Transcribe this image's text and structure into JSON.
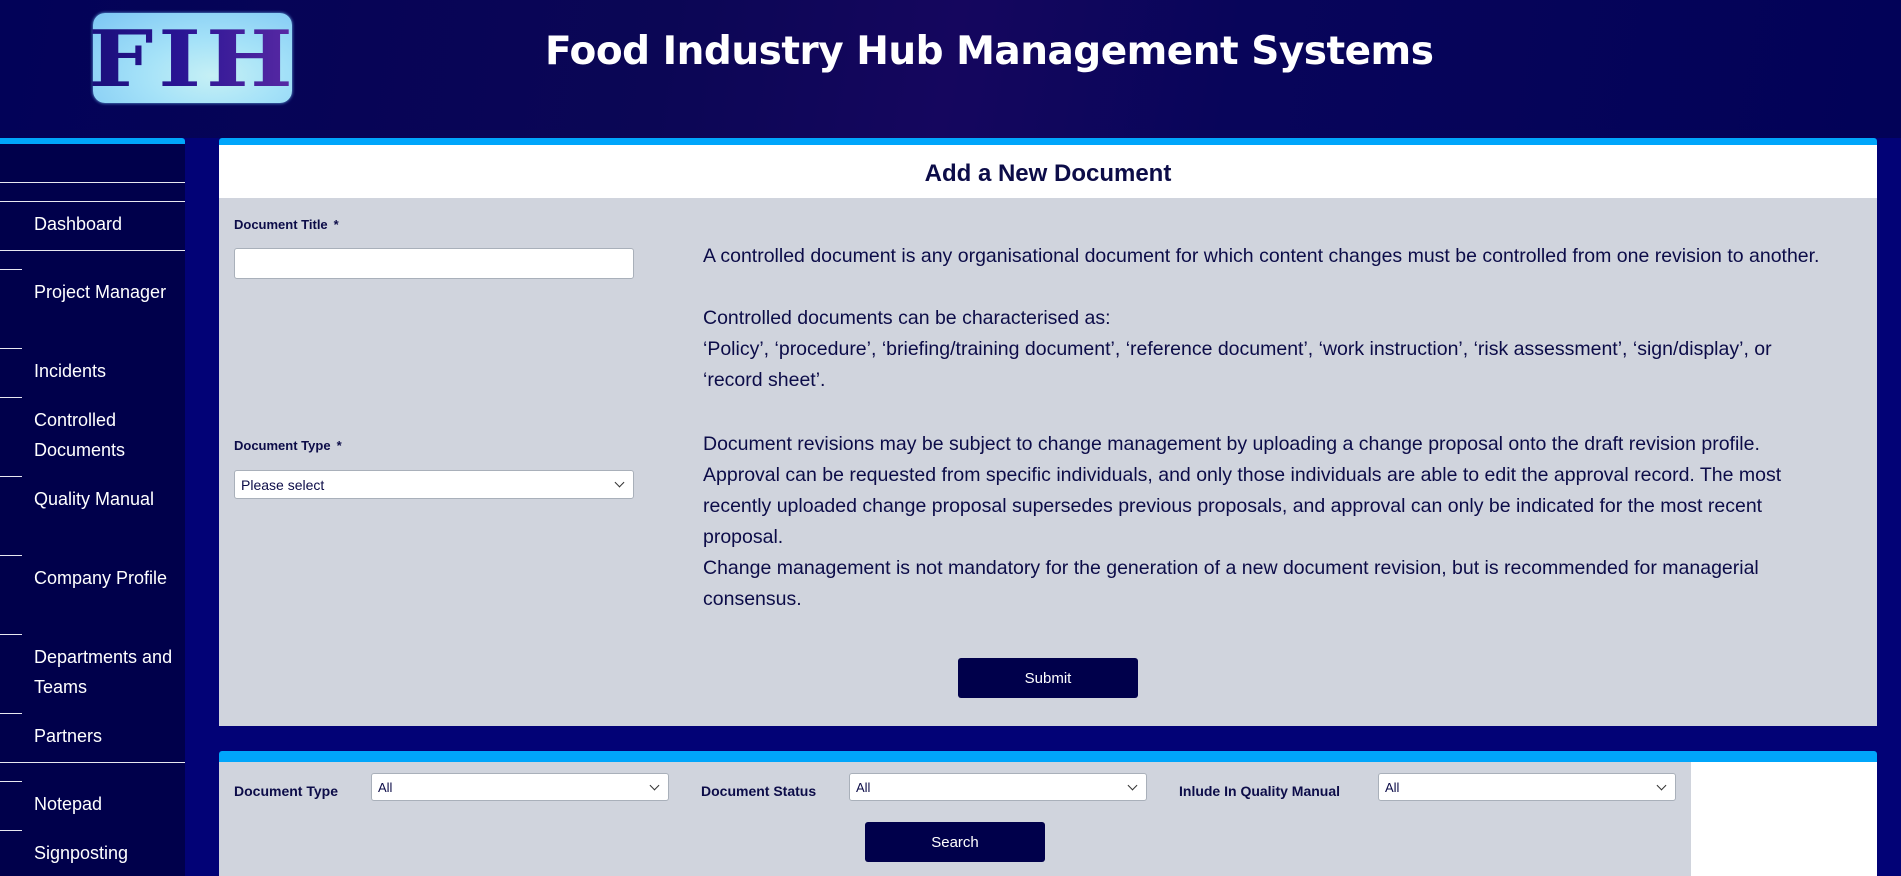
{
  "header": {
    "logo_text": "FIH",
    "title": "Food Industry Hub Management Systems"
  },
  "sidebar": {
    "items": [
      {
        "label": "Dashboard"
      },
      {
        "label": "Project Manager"
      },
      {
        "label": "Incidents"
      },
      {
        "label": "Controlled Documents"
      },
      {
        "label": "Quality Manual"
      },
      {
        "label": "Company Profile"
      },
      {
        "label": "Departments and Teams"
      },
      {
        "label": "Partners"
      },
      {
        "label": "Notepad"
      },
      {
        "label": "Signposting"
      }
    ]
  },
  "form": {
    "title": "Add a New Document",
    "document_title_label": "Document Title",
    "document_title_value": "",
    "required_marker": "*",
    "document_type_label": "Document Type",
    "document_type_value": "Please select",
    "submit_label": "Submit"
  },
  "info": {
    "p1": "A controlled document is any organisational document for which content changes must be controlled from one revision to another.",
    "p2_heading": "Controlled documents can be characterised as:",
    "p2_body": "‘Policy’, ‘procedure’, ‘briefing/training document’, ‘reference document’, ‘work instruction’, ‘risk assessment’, ‘sign/display’, or ‘record sheet’.",
    "p3_line1": "Document revisions may be subject to change management by uploading a change proposal onto the draft revision profile.",
    "p3_line2": "Approval can be requested from specific individuals, and only those individuals are able to edit the approval record. The most recently uploaded change proposal supersedes previous proposals, and approval can only be indicated for the most recent proposal.",
    "p3_line3": "Change management is not mandatory for the generation of a new document revision, but is recommended for managerial consensus."
  },
  "search": {
    "filters": [
      {
        "label": "Document Type",
        "value": "All"
      },
      {
        "label": "Document Status",
        "value": "All"
      },
      {
        "label": "Inlude In Quality Manual",
        "value": "All"
      }
    ],
    "search_label": "Search"
  },
  "colors": {
    "accent": "#00a6fb",
    "navy": "#00004b",
    "page_bg": "#020276",
    "panel_bg": "#d0d4dd"
  }
}
